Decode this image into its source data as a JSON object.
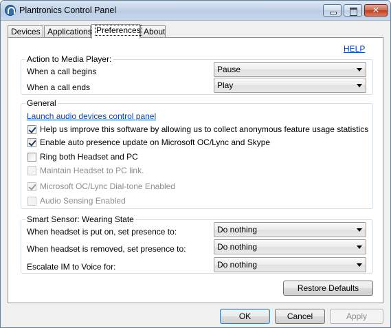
{
  "window": {
    "title": "Plantronics Control Panel",
    "close_glyph": "✕"
  },
  "tabs": [
    {
      "label": "Devices"
    },
    {
      "label": "Applications"
    },
    {
      "label": "Preferences"
    },
    {
      "label": "About"
    }
  ],
  "help_label": "HELP",
  "media_player": {
    "title": "Action to Media Player:",
    "call_begins_label": "When a call begins",
    "call_begins_value": "Pause",
    "call_ends_label": "When a call ends",
    "call_ends_value": "Play"
  },
  "general": {
    "title": "General",
    "launch_link": "Launch audio devices control panel",
    "options": [
      {
        "label": "Help us improve this software by allowing us to collect anonymous feature usage statistics",
        "checked": true,
        "enabled": true
      },
      {
        "label": "Enable auto presence update on Microsoft OC/Lync and Skype",
        "checked": true,
        "enabled": true
      },
      {
        "label": "Ring both Headset and PC",
        "checked": false,
        "enabled": true
      },
      {
        "label": "Maintain Headset to PC link.",
        "checked": false,
        "enabled": false
      },
      {
        "label": "Microsoft OC/Lync Dial-tone Enabled",
        "checked": true,
        "enabled": false
      },
      {
        "label": "Audio Sensing Enabled",
        "checked": false,
        "enabled": false
      }
    ]
  },
  "smart_sensor": {
    "title": "Smart Sensor: Wearing State",
    "put_on_label": "When headset is put on, set presence to:",
    "put_on_value": "Do nothing",
    "removed_label": "When headset is removed, set presence to:",
    "removed_value": "Do nothing",
    "escalate_label": "Escalate IM to Voice for:",
    "escalate_value": "Do nothing"
  },
  "buttons": {
    "restore_defaults": "Restore Defaults",
    "ok": "OK",
    "cancel": "Cancel",
    "apply": "Apply"
  }
}
